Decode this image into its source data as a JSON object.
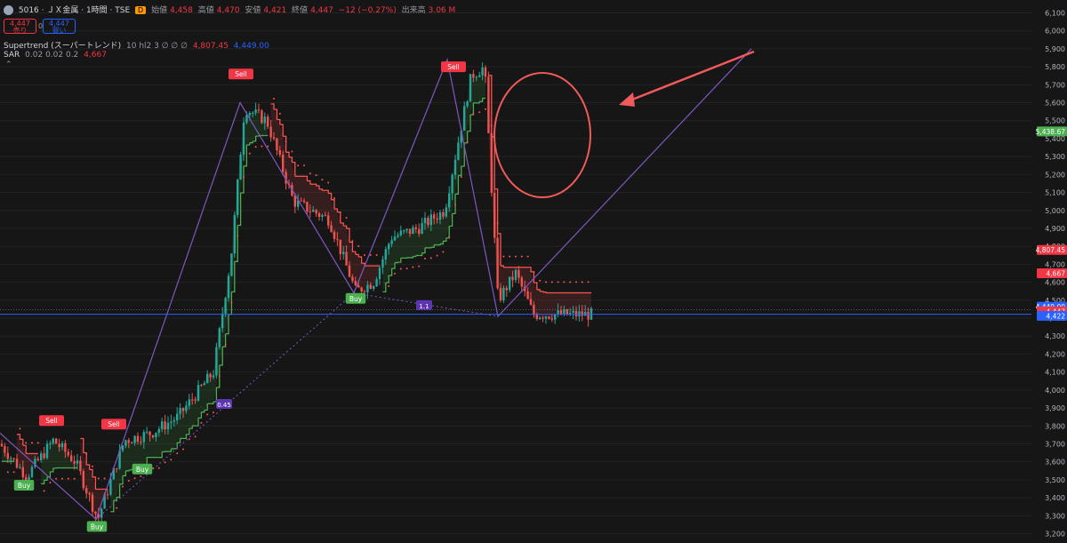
{
  "header": {
    "symbol": "5016 · ＪＸ金属 · 1時間 · TSE",
    "timeframe_badge": "D",
    "open_label": "始値",
    "open": "4,458",
    "high_label": "高値",
    "high": "4,470",
    "low_label": "安値",
    "low": "4,421",
    "close_label": "終値",
    "close": "4,447",
    "change": "−12 (−0.27%)",
    "volume_label": "出来高",
    "volume": "3.06 M"
  },
  "order": {
    "sell_price": "4,447",
    "sell_label": "売り",
    "spread": "0",
    "buy_price": "4,447",
    "buy_label": "買い"
  },
  "indicators": [
    {
      "name": "Supertrend (スーパートレンド)",
      "params": "10 hl2 3  ∅  ∅  ∅",
      "values": [
        "4,807.45",
        "4,449.00"
      ]
    },
    {
      "name": "SAR",
      "params": "0.02 0.02 0.2",
      "values": [
        "4,667"
      ]
    }
  ],
  "colors": {
    "bull": "#26a69a",
    "bear": "#ef5350",
    "supertrend_up": "#4caf50",
    "supertrend_down": "#ff5252",
    "sar": "#ff5252",
    "zigzag": "#7e57c2",
    "hline": "#2962ff",
    "arrow": "#f05a5a",
    "text": "#d1d4dc",
    "grid": "#232323"
  },
  "chart_data": {
    "type": "candlestick",
    "ylim": [
      3200,
      6100
    ],
    "y_ticks": [
      3200,
      3300,
      3400,
      3500,
      3600,
      3700,
      3800,
      3900,
      4000,
      4100,
      4200,
      4300,
      4400,
      4500,
      4600,
      4700,
      4800,
      4900,
      5000,
      5100,
      5200,
      5300,
      5400,
      5500,
      5600,
      5700,
      5800,
      5900,
      6000,
      6100
    ],
    "y_tick_labels": [
      "3,200",
      "3,300",
      "3,400",
      "3,500",
      "3,600",
      "3,700",
      "3,800",
      "3,900",
      "4,000",
      "4,100",
      "4,200",
      "4,300",
      "4,400",
      "4,500",
      "4,600",
      "4,700",
      "4,800",
      "4,900",
      "5,000",
      "5,100",
      "5,200",
      "5,300",
      "5,400",
      "5,500",
      "5,600",
      "5,700",
      "5,800",
      "5,900",
      "6,000",
      "6,100"
    ],
    "price_path": [
      [
        0,
        3700
      ],
      [
        0.03,
        3520
      ],
      [
        0.06,
        3720
      ],
      [
        0.085,
        3600
      ],
      [
        0.11,
        3280
      ],
      [
        0.14,
        3720
      ],
      [
        0.17,
        3760
      ],
      [
        0.2,
        3850
      ],
      [
        0.24,
        4100
      ],
      [
        0.26,
        4750
      ],
      [
        0.275,
        5570
      ],
      [
        0.3,
        5500
      ],
      [
        0.33,
        5050
      ],
      [
        0.37,
        4950
      ],
      [
        0.4,
        4550
      ],
      [
        0.42,
        4600
      ],
      [
        0.44,
        4850
      ],
      [
        0.47,
        4900
      ],
      [
        0.5,
        5000
      ],
      [
        0.53,
        5750
      ],
      [
        0.545,
        5800
      ],
      [
        0.56,
        4500
      ],
      [
        0.58,
        4650
      ],
      [
        0.6,
        4420
      ]
    ],
    "signals": [
      {
        "label": "Buy",
        "x_frac": 0.027,
        "price": 3470,
        "side": "buy"
      },
      {
        "label": "Sell",
        "x_frac": 0.058,
        "price": 3830,
        "side": "sell"
      },
      {
        "label": "Buy",
        "x_frac": 0.109,
        "price": 3240,
        "side": "buy"
      },
      {
        "label": "Sell",
        "x_frac": 0.128,
        "price": 3810,
        "side": "sell"
      },
      {
        "label": "Buy",
        "x_frac": 0.16,
        "price": 3560,
        "side": "buy"
      },
      {
        "label": "Sell",
        "x_frac": 0.271,
        "price": 5760,
        "side": "sell"
      },
      {
        "label": "Buy",
        "x_frac": 0.4,
        "price": 4510,
        "side": "buy"
      },
      {
        "label": "Sell",
        "x_frac": 0.51,
        "price": 5800,
        "side": "sell"
      }
    ],
    "zigzag": [
      [
        0,
        3760
      ],
      [
        0.108,
        3280
      ],
      [
        0.27,
        5600
      ],
      [
        0.398,
        4540
      ],
      [
        0.503,
        5840
      ],
      [
        0.56,
        4410
      ],
      [
        0.845,
        5900
      ]
    ],
    "fib_labels": [
      {
        "text": "0.45",
        "x_frac": 0.252,
        "price": 3920
      },
      {
        "text": "1.1",
        "x_frac": 0.477,
        "price": 4470
      }
    ],
    "price_tags": [
      {
        "text": "5,438.67",
        "price": 5440,
        "color": "#4caf50"
      },
      {
        "text": "4,807.45",
        "price": 4780,
        "color": "#f23645"
      },
      {
        "text": "4,667",
        "price": 4650,
        "color": "#f23645"
      },
      {
        "text": "4,449.00",
        "price": 4464,
        "color": "#2962ff"
      },
      {
        "text": "4,447",
        "price": 4438,
        "color": "#f23645"
      },
      {
        "text": "4,422",
        "price": 4413,
        "color": "#2962ff"
      }
    ],
    "horizontal_line_price": 4422
  }
}
